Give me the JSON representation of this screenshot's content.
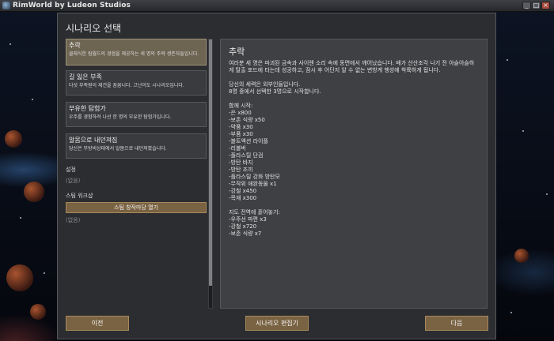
{
  "window": {
    "title": "RimWorld by Ludeon Studios",
    "controls": {
      "minimize": "_",
      "maximize": "□",
      "close": "×"
    }
  },
  "dialog": {
    "title": "시나리오 선택"
  },
  "scenarios": [
    {
      "name": "추락",
      "desc": "클래식한 림월드의 경험을 제공하는 세 명의 추락 생존자들입니다.",
      "selected": true
    },
    {
      "name": "길 잃은 부족",
      "desc": "다섯 부족원이 재건을 꿈꿉니다. 고난이도 시나리오입니다.",
      "selected": false
    },
    {
      "name": "부유한 탐험가",
      "desc": "우주를 경험하려 나선 한 명의 부유한 탐험가입니다.",
      "selected": false
    },
    {
      "name": "알몸으로 내던져짐",
      "desc": "당신은 무방비상태에서 알몸으로 내던져졌습니다.",
      "selected": false
    }
  ],
  "settings": {
    "label": "설정",
    "empty": "(없음)"
  },
  "workshop": {
    "label": "스팀 워크샵",
    "button": "스팀 창작마당 열기",
    "empty": "(없음)"
  },
  "description": {
    "title": "추락",
    "intro": "여러분 세 명은 파괴된 금속과 사이렌 소리 속에 동면에서 깨어났습니다. 배가 산산조각 나기 전 아슬아슬하게 탈출 포드에 타는데 성공하고, 잠시 후 어딘지 알 수 없는 변방계 행성에 착륙하게 됩니다.",
    "faction_line1": "당신의 세력은 외부인들입니다.",
    "faction_line2": "8명 중에서 선택한 3명으로 시작합니다.",
    "start_with_label": "함께 시작:",
    "start_items": [
      "-은 x800",
      "-보존 식량 x50",
      "-약품 x30",
      "-부품 x30",
      "-볼트액션 라이플",
      "-리볼버",
      "-플라스틸 단검",
      "-방탄 바지",
      "-방탄 조끼",
      "-플라스틸 강화 방탄모",
      "-무작위 애완동물 x1",
      "-강철 x450",
      "-목재 x300"
    ],
    "scatter_label": "지도 전역에 흩어놓기:",
    "scatter_items": [
      "-우주선 파편 x3",
      "-강철 x720",
      "-보존 식량 x7"
    ]
  },
  "buttons": {
    "back": "이전",
    "editor": "시나리오 편집기",
    "next": "다음"
  },
  "colors": {
    "dialog_bg": "#2b2d30",
    "selected_item": "#6e6452",
    "button_bg": "#7a6343"
  }
}
